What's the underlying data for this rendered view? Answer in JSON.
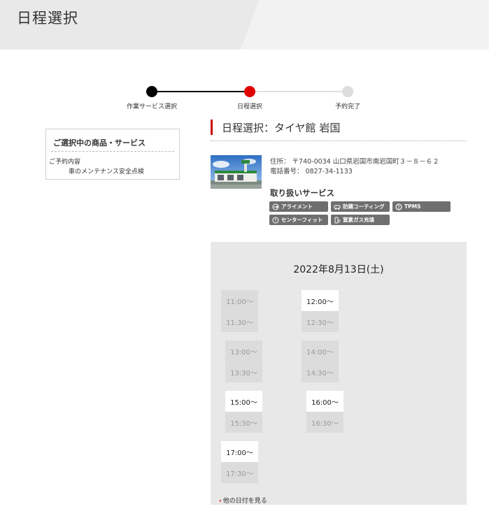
{
  "header": {
    "title": "日程選択"
  },
  "stepper": {
    "steps": [
      {
        "label": "作業サービス選択",
        "state": "done",
        "color": "#000000"
      },
      {
        "label": "日程選択",
        "state": "current",
        "color": "#e00000"
      },
      {
        "label": "予約完了",
        "state": "todo",
        "color": "#dddddd"
      }
    ]
  },
  "selection": {
    "title": "ご選択中の商品・サービス",
    "reservation_label": "ご予約内容",
    "reservation_value": "車のメンテナンス安全点検"
  },
  "store": {
    "heading": "日程選択：タイヤ館 岩国",
    "address": "住所： 〒740-0034 山口県岩国市南岩国町３－８－６２",
    "phone": "電話番号： 0827-34-1133",
    "services_title": "取り扱いサービス",
    "services": [
      {
        "label": "アライメント",
        "icon": "alignment-icon"
      },
      {
        "label": "防錆コーティング",
        "icon": "car-coating-icon"
      },
      {
        "label": "TPMS",
        "icon": "tpms-icon"
      },
      {
        "label": "センターフィット",
        "icon": "center-fit-icon"
      },
      {
        "label": "窒素ガス充填",
        "icon": "nitrogen-icon"
      }
    ]
  },
  "calendar": {
    "date": "2022年8月13日(土)",
    "slots": [
      {
        "time": "11:00～",
        "available": false
      },
      {
        "time": "11:30～",
        "available": false
      },
      {
        "time": "12:00～",
        "available": true
      },
      {
        "time": "12:30～",
        "available": false
      },
      {
        "time": "13:00～",
        "available": false
      },
      {
        "time": "13:30～",
        "available": false
      },
      {
        "time": "14:00～",
        "available": false
      },
      {
        "time": "14:30～",
        "available": false
      },
      {
        "time": "15:00～",
        "available": true
      },
      {
        "time": "15:30～",
        "available": false
      },
      {
        "time": "16:00～",
        "available": true
      },
      {
        "time": "16:30～",
        "available": false
      },
      {
        "time": "17:00～",
        "available": true
      },
      {
        "time": "17:30～",
        "available": false
      }
    ],
    "other_dates_link": "他の日付を見る"
  },
  "colors": {
    "accent": "#cc0000",
    "service_badge": "#6f6f6f",
    "panel_bg": "#e8e8e8"
  }
}
